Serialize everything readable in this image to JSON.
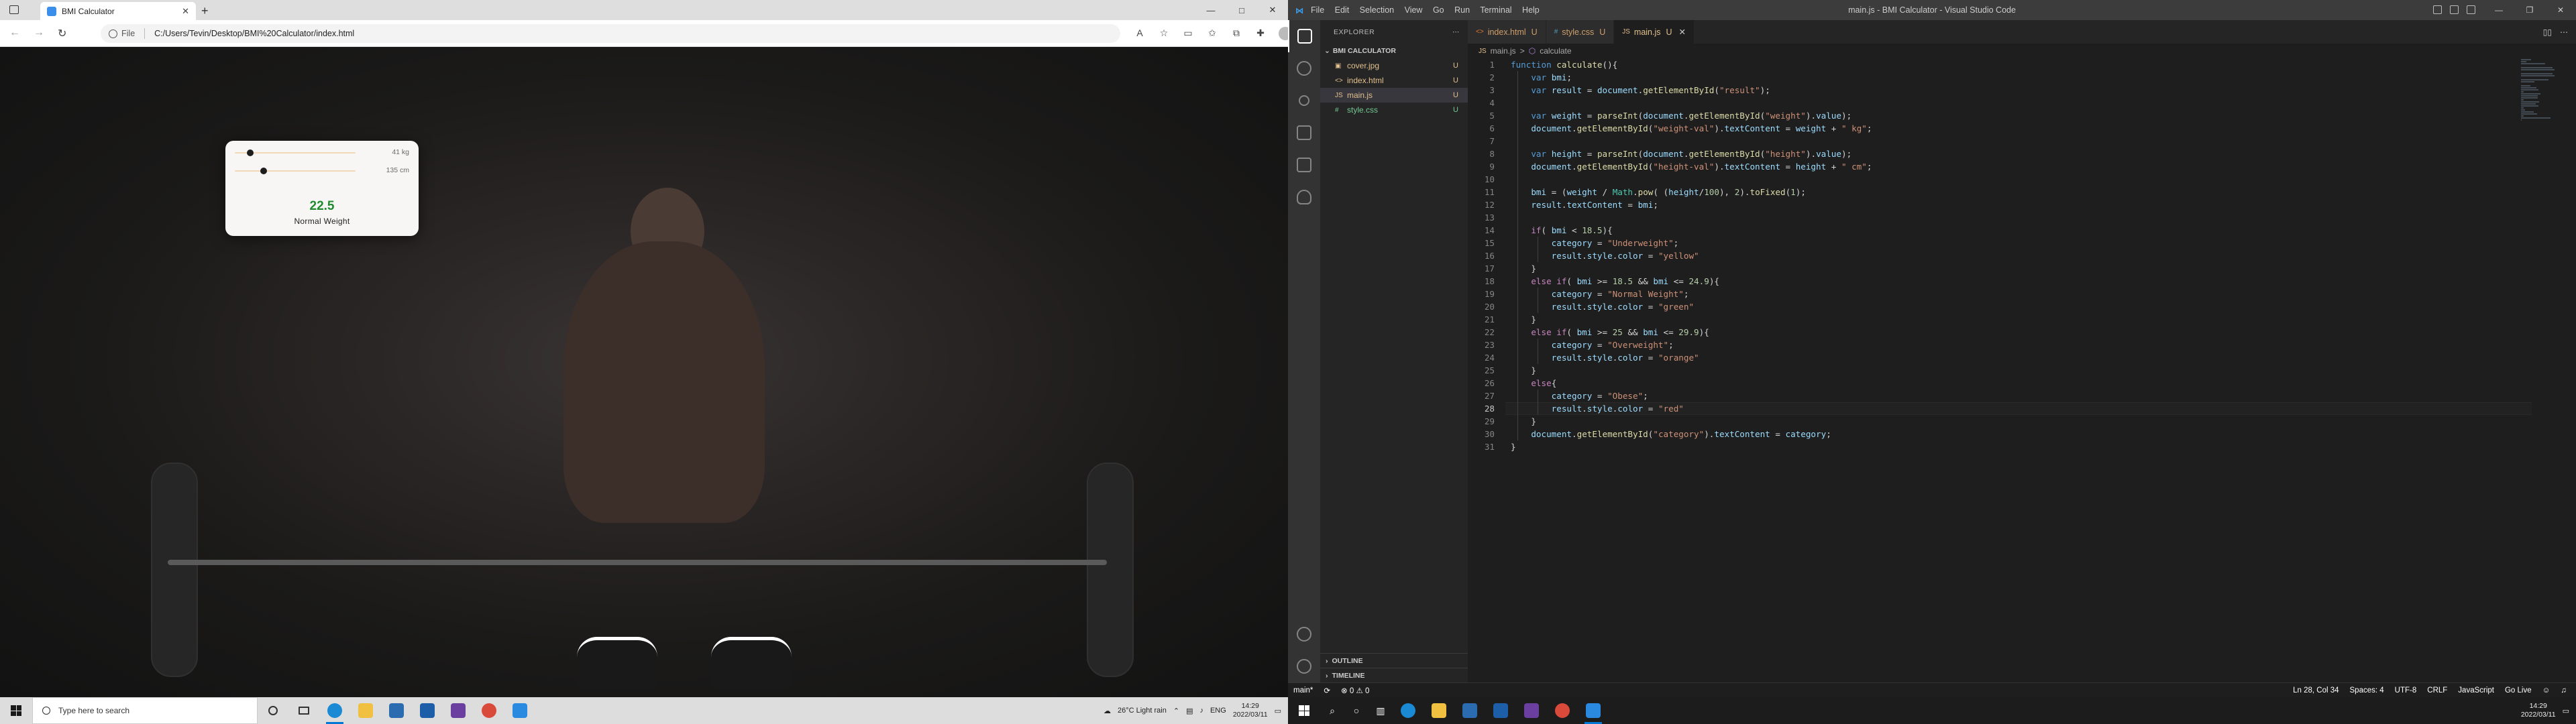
{
  "browser": {
    "tab_title": "BMI Calculator",
    "url_scheme": "File",
    "url": "C:/Users/Tevin/Desktop/BMI%20Calculator/index.html",
    "new_tab": "+",
    "back_icon": "arrow-left-icon",
    "forward_icon": "arrow-right-icon",
    "refresh_icon": "refresh-icon",
    "window_buttons": [
      "—",
      "□",
      "✕"
    ]
  },
  "app": {
    "weight_value": "41 kg",
    "height_value": "135 cm",
    "weight_slider_fraction": 0.13,
    "height_slider_fraction": 0.24,
    "bmi": "22.5",
    "category": "Normal Weight",
    "bmi_color": "#1f8a2e",
    "slider_track_color": "#f2d8b8"
  },
  "taskbar_left": {
    "search_placeholder": "Type here to search",
    "weather": "26°C  Light rain",
    "lang": "ENG",
    "time": "14:29",
    "date": "2022/03/11"
  },
  "vscode": {
    "menu": [
      "File",
      "Edit",
      "Selection",
      "View",
      "Go",
      "Run",
      "Terminal",
      "Help"
    ],
    "window_title": "main.js - BMI Calculator - Visual Studio Code",
    "explorer_title": "EXPLORER",
    "folder": "BMI CALCULATOR",
    "files": [
      {
        "name": "cover.jpg",
        "icon": "▣",
        "status": "U",
        "color": "#e2c08d"
      },
      {
        "name": "index.html",
        "icon": "<>",
        "status": "U",
        "color": "#e2c08d"
      },
      {
        "name": "main.js",
        "icon": "JS",
        "status": "U",
        "color": "#e2c08d"
      },
      {
        "name": "style.css",
        "icon": "#",
        "status": "U",
        "color": "#73c991"
      }
    ],
    "tabs": [
      {
        "name": "index.html",
        "status": "U",
        "icon": "<>"
      },
      {
        "name": "style.css",
        "status": "U",
        "icon": "#"
      },
      {
        "name": "main.js",
        "status": "U",
        "icon": "JS"
      }
    ],
    "breadcrumb_file": "main.js",
    "breadcrumb_sep": ">",
    "breadcrumb_symbol": "calculate",
    "outline": "OUTLINE",
    "timeline": "TIMELINE",
    "status": {
      "branch": "main*",
      "errors": "⊗ 0 ⚠ 0",
      "position": "Ln 28, Col 34",
      "spaces": "Spaces: 4",
      "encoding": "UTF-8",
      "eol": "CRLF",
      "language": "JavaScript",
      "live": "Go Live"
    },
    "current_line": 28,
    "code": [
      [
        [
          "kw",
          "function "
        ],
        [
          "fn",
          "calculate"
        ],
        [
          "",
          "(){"
        ]
      ],
      [
        [
          "",
          "    "
        ],
        [
          "kw",
          "var "
        ],
        [
          "var",
          "bmi"
        ],
        [
          "",
          ";"
        ]
      ],
      [
        [
          "",
          "    "
        ],
        [
          "kw",
          "var "
        ],
        [
          "var",
          "result"
        ],
        [
          "",
          " = "
        ],
        [
          "var",
          "document"
        ],
        [
          "",
          "."
        ],
        [
          "fn",
          "getElementById"
        ],
        [
          "",
          "("
        ],
        [
          "str",
          "\"result\""
        ],
        [
          "",
          ");"
        ]
      ],
      [],
      [
        [
          "",
          "    "
        ],
        [
          "kw",
          "var "
        ],
        [
          "var",
          "weight"
        ],
        [
          "",
          " = "
        ],
        [
          "fn",
          "parseInt"
        ],
        [
          "",
          "("
        ],
        [
          "var",
          "document"
        ],
        [
          "",
          "."
        ],
        [
          "fn",
          "getElementById"
        ],
        [
          "",
          "("
        ],
        [
          "str",
          "\"weight\""
        ],
        [
          "",
          ")."
        ],
        [
          "var",
          "value"
        ],
        [
          "",
          ");"
        ]
      ],
      [
        [
          "",
          "    "
        ],
        [
          "var",
          "document"
        ],
        [
          "",
          "."
        ],
        [
          "fn",
          "getElementById"
        ],
        [
          "",
          "("
        ],
        [
          "str",
          "\"weight-val\""
        ],
        [
          "",
          ")."
        ],
        [
          "var",
          "textContent"
        ],
        [
          "",
          " = "
        ],
        [
          "var",
          "weight"
        ],
        [
          "",
          " + "
        ],
        [
          "str",
          "\" kg\""
        ],
        [
          "",
          ";"
        ]
      ],
      [],
      [
        [
          "",
          "    "
        ],
        [
          "kw",
          "var "
        ],
        [
          "var",
          "height"
        ],
        [
          "",
          " = "
        ],
        [
          "fn",
          "parseInt"
        ],
        [
          "",
          "("
        ],
        [
          "var",
          "document"
        ],
        [
          "",
          "."
        ],
        [
          "fn",
          "getElementById"
        ],
        [
          "",
          "("
        ],
        [
          "str",
          "\"height\""
        ],
        [
          "",
          ")."
        ],
        [
          "var",
          "value"
        ],
        [
          "",
          ");"
        ]
      ],
      [
        [
          "",
          "    "
        ],
        [
          "var",
          "document"
        ],
        [
          "",
          "."
        ],
        [
          "fn",
          "getElementById"
        ],
        [
          "",
          "("
        ],
        [
          "str",
          "\"height-val\""
        ],
        [
          "",
          ")."
        ],
        [
          "var",
          "textContent"
        ],
        [
          "",
          " = "
        ],
        [
          "var",
          "height"
        ],
        [
          "",
          " + "
        ],
        [
          "str",
          "\" cm\""
        ],
        [
          "",
          ";"
        ]
      ],
      [],
      [
        [
          "",
          "    "
        ],
        [
          "var",
          "bmi"
        ],
        [
          "",
          " = ("
        ],
        [
          "var",
          "weight"
        ],
        [
          "",
          " / "
        ],
        [
          "obj",
          "Math"
        ],
        [
          "",
          "."
        ],
        [
          "fn",
          "pow"
        ],
        [
          "",
          "( ("
        ],
        [
          "var",
          "height"
        ],
        [
          "",
          "/"
        ],
        [
          "num",
          "100"
        ],
        [
          "",
          "), "
        ],
        [
          "num",
          "2"
        ],
        [
          "",
          ")."
        ],
        [
          "fn",
          "toFixed"
        ],
        [
          "",
          "("
        ],
        [
          "num",
          "1"
        ],
        [
          "",
          ");"
        ]
      ],
      [
        [
          "",
          "    "
        ],
        [
          "var",
          "result"
        ],
        [
          "",
          "."
        ],
        [
          "var",
          "textContent"
        ],
        [
          "",
          " = "
        ],
        [
          "var",
          "bmi"
        ],
        [
          "",
          ";"
        ]
      ],
      [],
      [
        [
          "",
          "    "
        ],
        [
          "ctl",
          "if"
        ],
        [
          "",
          "( "
        ],
        [
          "var",
          "bmi"
        ],
        [
          "",
          " < "
        ],
        [
          "num",
          "18.5"
        ],
        [
          "",
          "){"
        ]
      ],
      [
        [
          "",
          "        "
        ],
        [
          "var",
          "category"
        ],
        [
          "",
          " = "
        ],
        [
          "str",
          "\"Underweight\""
        ],
        [
          "",
          ";"
        ]
      ],
      [
        [
          "",
          "        "
        ],
        [
          "var",
          "result"
        ],
        [
          "",
          "."
        ],
        [
          "var",
          "style"
        ],
        [
          "",
          "."
        ],
        [
          "var",
          "color"
        ],
        [
          "",
          " = "
        ],
        [
          "str",
          "\"yellow\""
        ]
      ],
      [
        [
          "",
          "    }"
        ]
      ],
      [
        [
          "",
          "    "
        ],
        [
          "ctl",
          "else if"
        ],
        [
          "",
          "( "
        ],
        [
          "var",
          "bmi"
        ],
        [
          "",
          " >= "
        ],
        [
          "num",
          "18.5"
        ],
        [
          "",
          " && "
        ],
        [
          "var",
          "bmi"
        ],
        [
          "",
          " <= "
        ],
        [
          "num",
          "24.9"
        ],
        [
          "",
          "){"
        ]
      ],
      [
        [
          "",
          "        "
        ],
        [
          "var",
          "category"
        ],
        [
          "",
          " = "
        ],
        [
          "str",
          "\"Normal Weight\""
        ],
        [
          "",
          ";"
        ]
      ],
      [
        [
          "",
          "        "
        ],
        [
          "var",
          "result"
        ],
        [
          "",
          "."
        ],
        [
          "var",
          "style"
        ],
        [
          "",
          "."
        ],
        [
          "var",
          "color"
        ],
        [
          "",
          " = "
        ],
        [
          "str",
          "\"green\""
        ]
      ],
      [
        [
          "",
          "    }"
        ]
      ],
      [
        [
          "",
          "    "
        ],
        [
          "ctl",
          "else if"
        ],
        [
          "",
          "( "
        ],
        [
          "var",
          "bmi"
        ],
        [
          "",
          " >= "
        ],
        [
          "num",
          "25"
        ],
        [
          "",
          " && "
        ],
        [
          "var",
          "bmi"
        ],
        [
          "",
          " <= "
        ],
        [
          "num",
          "29.9"
        ],
        [
          "",
          "){"
        ]
      ],
      [
        [
          "",
          "        "
        ],
        [
          "var",
          "category"
        ],
        [
          "",
          " = "
        ],
        [
          "str",
          "\"Overweight\""
        ],
        [
          "",
          ";"
        ]
      ],
      [
        [
          "",
          "        "
        ],
        [
          "var",
          "result"
        ],
        [
          "",
          "."
        ],
        [
          "var",
          "style"
        ],
        [
          "",
          "."
        ],
        [
          "var",
          "color"
        ],
        [
          "",
          " = "
        ],
        [
          "str",
          "\"orange\""
        ]
      ],
      [
        [
          "",
          "    }"
        ]
      ],
      [
        [
          "",
          "    "
        ],
        [
          "ctl",
          "else"
        ],
        [
          "",
          "{"
        ]
      ],
      [
        [
          "",
          "        "
        ],
        [
          "var",
          "category"
        ],
        [
          "",
          " = "
        ],
        [
          "str",
          "\"Obese\""
        ],
        [
          "",
          ";"
        ]
      ],
      [
        [
          "",
          "        "
        ],
        [
          "var",
          "result"
        ],
        [
          "",
          "."
        ],
        [
          "var",
          "style"
        ],
        [
          "",
          "."
        ],
        [
          "var",
          "color"
        ],
        [
          "",
          " = "
        ],
        [
          "str",
          "\"red\""
        ]
      ],
      [
        [
          "",
          "    }"
        ]
      ],
      [
        [
          "",
          "    "
        ],
        [
          "var",
          "document"
        ],
        [
          "",
          "."
        ],
        [
          "fn",
          "getElementById"
        ],
        [
          "",
          "("
        ],
        [
          "str",
          "\"category\""
        ],
        [
          "",
          ")."
        ],
        [
          "var",
          "textContent"
        ],
        [
          "",
          " = "
        ],
        [
          "var",
          "category"
        ],
        [
          "",
          ";"
        ]
      ],
      [
        [
          "",
          "}"
        ]
      ]
    ]
  },
  "taskbar_right": {
    "time": "14:29",
    "date": "2022/03/11"
  }
}
